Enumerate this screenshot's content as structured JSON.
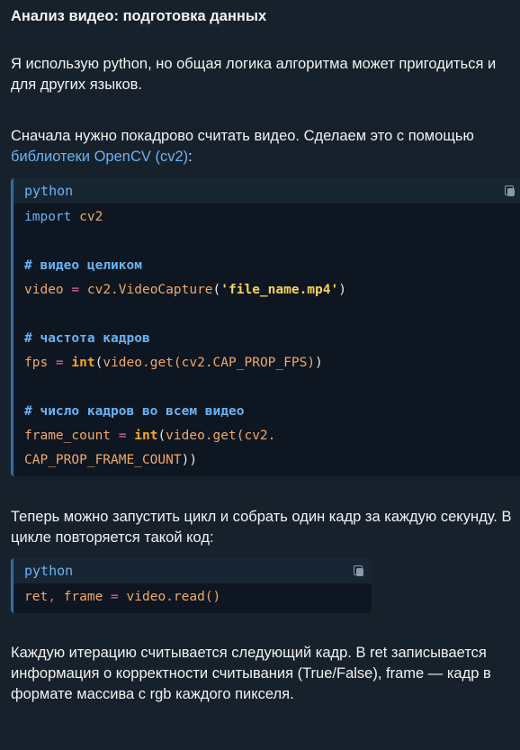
{
  "message": {
    "title": "Анализ видео: подготовка данных",
    "p1": "Я использую python, но общая логика алгоритма может пригодиться и для других языков.",
    "p2_before": "Сначала нужно покадрово считать видео. Сделаем это с помощью ",
    "p2_link": "библиотеки OpenCV (cv2)",
    "p2_after": ":",
    "p3": "Теперь можно запустить цикл и собрать один кадр за каждую секунду. В цикле повторяется такой код:",
    "p4": "Каждую итерацию считывается следующий кадр. В ret записывается информация о корректности считывания (True/False), frame — кадр в формате массива с rgb каждого пикселя."
  },
  "code_block_1": {
    "language": "python",
    "import_kw": "import",
    "import_mod": " cv2",
    "comment_video": "# видео целиком",
    "video_var": "video",
    "video_eq": " = ",
    "video_call": "cv2.VideoCapture",
    "video_arg": "'file_name.mp4'",
    "comment_fps": "# частота кадров",
    "fps_var": "fps",
    "fps_eq": " = ",
    "fps_int": "int",
    "fps_call": "video.get(cv2.CAP_PROP_FPS)",
    "comment_count": "# число кадров во всем видео",
    "count_var": "frame_count",
    "count_eq": " = ",
    "count_int": "int",
    "count_call_1": "video.get(cv2.",
    "count_call_2": "CAP_PROP_FRAME_COUNT",
    "count_close": "))"
  },
  "code_block_2": {
    "language": "python",
    "ret_var": "ret",
    "comma": ",",
    "frame_var": " frame",
    "eq": " = ",
    "call": "video.read()"
  },
  "colors": {
    "background": "#17212b",
    "code_background": "#0e1621",
    "code_header": "#182533",
    "link": "#6ab3f3",
    "accent_border": "#2f6ea5"
  },
  "icons": [
    "copy-icon"
  ]
}
